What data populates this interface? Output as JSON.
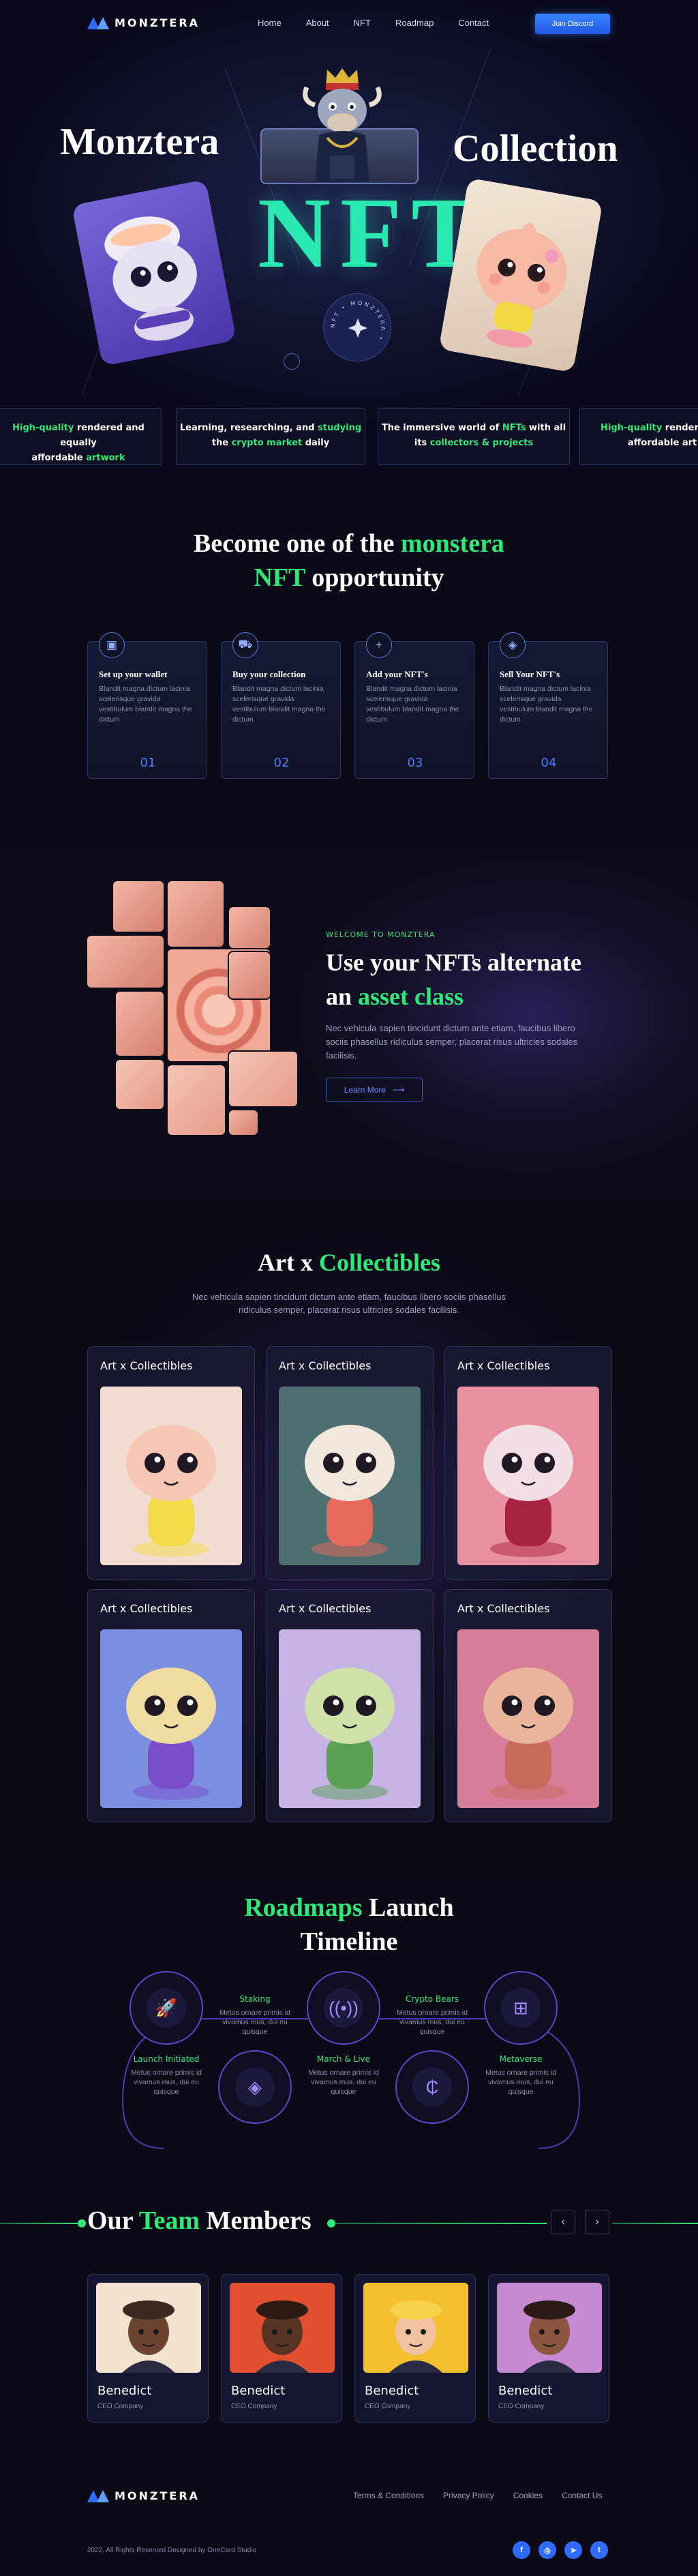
{
  "nav": {
    "brand": "MONZTERA",
    "links": [
      "Home",
      "About",
      "NFT",
      "Roadmap",
      "Contact"
    ],
    "cta": "Join Discord"
  },
  "hero": {
    "word_left": "Monztera",
    "word_right": "Collection",
    "big": "NFT",
    "badge_text": "NFT • MONZTERA •",
    "ticker": [
      {
        "a": "High-quality",
        "b": " rendered and equally",
        "c": "affordable ",
        "d": "artwork",
        "hl": [
          "a",
          "d"
        ]
      },
      {
        "a": "Learning, researching, and ",
        "b": "studying",
        "c": "the ",
        "d": "crypto market",
        "e": " daily"
      },
      {
        "a": "The immersive world of ",
        "b": "NFTs",
        "c": " with all",
        "d": "its ",
        "e": "collectors & projects"
      },
      {
        "a": "High-quality",
        "b": " rendered",
        "c": "affordable art"
      }
    ]
  },
  "opportunity": {
    "title_1": "Become one of the ",
    "title_hl": "monstera",
    "title_2_hl": "NFT",
    "title_2": " opportunity",
    "steps": [
      {
        "icon": "wallet-icon",
        "title": "Set up your wallet",
        "desc": "Blandit magna dictum lacinia scelerisque gravida vestibulum blandit magna the dictum",
        "num": "01"
      },
      {
        "icon": "cart-icon",
        "title": "Buy your collection",
        "desc": "Blandit magna dictum lacinia scelerisque gravida vestibulum blandit magna the dictum",
        "num": "02"
      },
      {
        "icon": "plus-icon",
        "title": "Add your NFT's",
        "desc": "Blandit magna dictum lacinia scelerisque gravida vestibulum blandit magna the dictum",
        "num": "03"
      },
      {
        "icon": "tag-icon",
        "title": "Sell Your NFT's",
        "desc": "Blandit magna dictum lacinia scelerisque gravida vestibulum blandit magna the dictum",
        "num": "04"
      }
    ]
  },
  "asset": {
    "eyebrow": "WELCOME TO MONZTERA",
    "title_1": "Use your NFTs alternate",
    "title_2": "an ",
    "title_hl": "asset class",
    "desc": "Nec vehicula sapien tincidunt dictum ante etiam, faucibus libero sociis phasellus ridiculus semper, placerat risus ultricies sodales facilisis.",
    "button": "Learn More"
  },
  "collectibles": {
    "title_1": "Art x ",
    "title_hl": "Collectibles",
    "desc_1": "Nec vehicula sapien tincidunt dictum ante etiam, faucibus libero sociis phasellus",
    "desc_2": "ridiculus semper, placerat risus ultricies sodales facilisis.",
    "cards": [
      {
        "title": "Art x Collectibles",
        "bg": "#f2dcd2",
        "body": "#f7c7b5",
        "accent": "#f2dc4a"
      },
      {
        "title": "Art x Collectibles",
        "bg": "#4d6f72",
        "body": "#f1e7dc",
        "accent": "#e76a5a"
      },
      {
        "title": "Art x Collectibles",
        "bg": "#e88fa0",
        "body": "#f2dfe6",
        "accent": "#a8243e"
      },
      {
        "title": "Art x Collectibles",
        "bg": "#7c8ee0",
        "body": "#f0dca0",
        "accent": "#7a4ec9"
      },
      {
        "title": "Art x Collectibles",
        "bg": "#c7b2e6",
        "body": "#cfe0a8",
        "accent": "#5aa055"
      },
      {
        "title": "Art x Collectibles",
        "bg": "#d67d9a",
        "body": "#e8b49a",
        "accent": "#c66b5b"
      }
    ]
  },
  "roadmap": {
    "title_hl": "Roadmaps",
    "title_1": " Launch",
    "title_2": "Timeline",
    "items": [
      {
        "icon": "rocket-icon",
        "label": "Launch Initiated",
        "desc": "Metus ornare primis id vivamus mus, dui eu quisque",
        "pos": "bottom"
      },
      {
        "icon": "layers-icon",
        "label": "Staking",
        "desc": "Metus ornare primis id vivamus mus, dui eu quisque",
        "pos": "top"
      },
      {
        "icon": "broadcast-icon",
        "label": "March & Live",
        "desc": "Metus ornare primis id vivamus mus, dui eu quisque",
        "pos": "bottom"
      },
      {
        "icon": "coin-icon",
        "label": "Crypto Bears",
        "desc": "Metus ornare primis id vivamus mus, dui eu quisque",
        "pos": "top"
      },
      {
        "icon": "metaverse-icon",
        "label": "Metaverse",
        "desc": "Metus ornare primis id vivamus mus, dui eu quisque",
        "pos": "bottom"
      }
    ]
  },
  "team": {
    "title_1": "Our ",
    "title_hl": "Team",
    "title_2": " Members",
    "prev": "‹",
    "next": "›",
    "members": [
      {
        "name": "Benedict",
        "role": "CEO Company",
        "bg": "#f3e2cf",
        "skin": "#6b4330",
        "hat": "#3a2a22"
      },
      {
        "name": "Benedict",
        "role": "CEO Company",
        "bg": "#e0502f",
        "skin": "#5a3423",
        "hat": "#2c1a14"
      },
      {
        "name": "Benedict",
        "role": "CEO Company",
        "bg": "#f4bf2e",
        "skin": "#f2c1a0",
        "hat": "#f6d24a"
      },
      {
        "name": "Benedict",
        "role": "CEO Company",
        "bg": "#c68ad2",
        "skin": "#8a5640",
        "hat": "#2b1a18"
      }
    ]
  },
  "footer": {
    "brand": "MONZTERA",
    "links": [
      "Terms & Conditions",
      "Privacy Policy",
      "Cookies",
      "Contact Us"
    ],
    "copyright": "2022, All Rights Reserved Designed by OneCard Studio",
    "socials": [
      "facebook-icon",
      "instagram-icon",
      "telegram-icon",
      "twitter-icon"
    ]
  },
  "colors": {
    "accent_green": "#2ee87a",
    "accent_blue": "#2f6bff",
    "hero_teal": "#29e8b0"
  }
}
